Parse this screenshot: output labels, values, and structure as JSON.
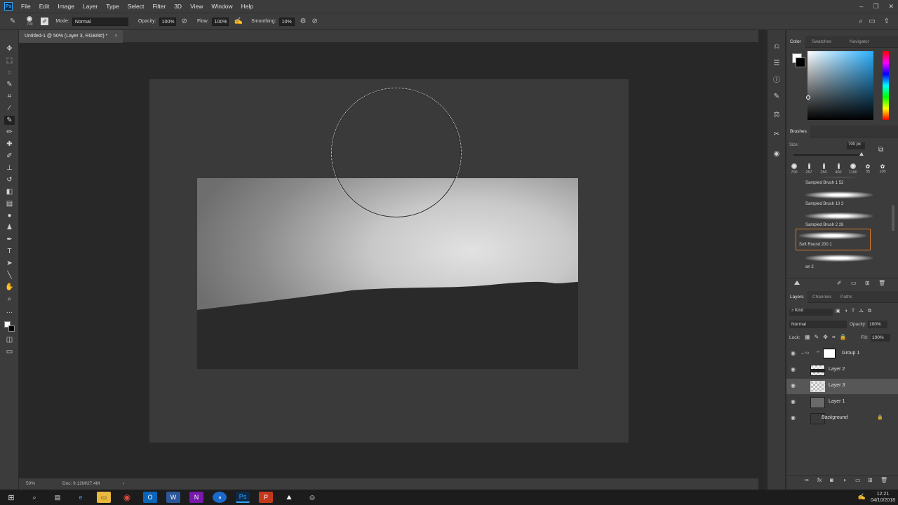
{
  "app": {
    "logo": "Ps",
    "name": "Adobe Photoshop"
  },
  "menu": [
    "File",
    "Edit",
    "Image",
    "Layer",
    "Type",
    "Select",
    "Filter",
    "3D",
    "View",
    "Window",
    "Help"
  ],
  "options": {
    "brush_size": "700",
    "mode_label": "Mode:",
    "mode_value": "Normal",
    "opacity_label": "Opacity:",
    "opacity_value": "100%",
    "flow_label": "Flow:",
    "flow_value": "100%",
    "smoothing_label": "Smoothing:",
    "smoothing_value": "10%"
  },
  "document": {
    "tab_title": "Untitled-1 @ 50% (Layer 3, RGB/8#) *",
    "close": "×"
  },
  "status": {
    "zoom": "50%",
    "doc_info": "Doc: 9.12M/27.4M",
    "arrow": "›"
  },
  "color_panel": {
    "tabs": [
      "Color",
      "Swatches",
      "Navigator"
    ],
    "active_tab": "Color"
  },
  "brushes_panel": {
    "title": "Brushes",
    "size_label": "Size:",
    "size_value": "700 px",
    "presets": [
      "700",
      "257",
      "250",
      "400",
      "1100",
      "35",
      "100"
    ],
    "list": [
      "Sampled Brush 1 52",
      "Sampled Brush 10 3",
      "Sampled Brush 2 28",
      "Soft Round 200 1",
      "an 2"
    ],
    "selected": "Soft Round 200 1"
  },
  "layers_panel": {
    "tabs": [
      "Layers",
      "Channels",
      "Paths"
    ],
    "active_tab": "Layers",
    "kind": "Kind",
    "blend_mode": "Normal",
    "opacity_label": "Opacity:",
    "opacity_value": "100%",
    "lock_label": "Lock:",
    "fill_label": "Fill:",
    "fill_value": "100%",
    "layers": [
      {
        "name": "Group 1",
        "type": "group"
      },
      {
        "name": "Layer 2",
        "type": "layer"
      },
      {
        "name": "Layer 3",
        "type": "layer",
        "selected": true
      },
      {
        "name": "Layer 1",
        "type": "layer"
      },
      {
        "name": "Background",
        "type": "background",
        "locked": true
      }
    ]
  },
  "taskbar": {
    "icons": [
      "windows-icon",
      "search-icon",
      "task-view-icon",
      "edge-icon",
      "file-explorer-icon",
      "chrome-icon",
      "outlook-icon",
      "word-icon",
      "onenote-icon",
      "whiteboard-icon",
      "photoshop-icon",
      "powerpoint-icon",
      "photos-icon",
      "app-icon"
    ],
    "time": "12:21",
    "date": "04/10/2018"
  },
  "colors": {
    "accent": "#31a8ff",
    "selection_border": "#e07a2a"
  }
}
